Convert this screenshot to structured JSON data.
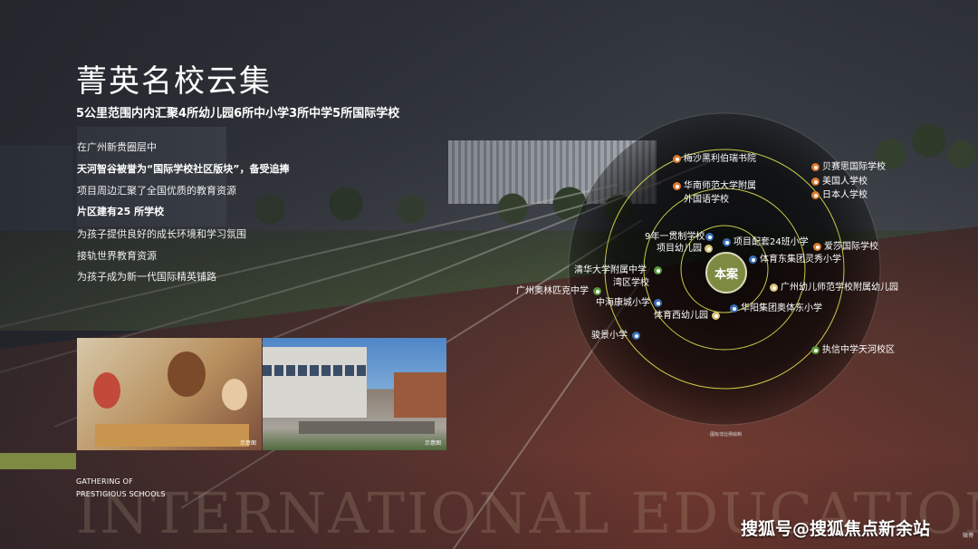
{
  "title": "菁英名校云集",
  "subtitle": "5公里范围内内汇聚4所幼儿园6所中小学3所中学5所国际学校",
  "desc": [
    "在广州新贵圈层中",
    "天河智谷被誉为“国际学校社区版块”，备受追捧",
    "项目周边汇聚了全国优质的教育资源",
    "片区建有25 所学校",
    "为孩子提供良好的成长环境和学习氛围",
    "接轨世界教育资源",
    "为孩子成为新一代国际精英铺路"
  ],
  "photos": {
    "caption1": "示意图",
    "caption2": "示意图"
  },
  "gathering": [
    "GATHERING OF",
    "PRESTIGIOUS SCHOOLS"
  ],
  "watermark": "INTERNATIONAL EDUCATION",
  "center_label": "本案",
  "map_note": "· 图标非比例绘制",
  "schools": [
    {
      "name": "梅沙黑利伯瑞书院",
      "color": "orange"
    },
    {
      "name": "华南师范大学附属",
      "color": "orange"
    },
    {
      "name": "外国语学校",
      "color": "orange"
    },
    {
      "name": "贝赛思国际学校",
      "color": "orange"
    },
    {
      "name": "美国人学校",
      "color": "orange"
    },
    {
      "name": "日本人学校",
      "color": "orange"
    },
    {
      "name": "爱莎国际学校",
      "color": "orange"
    },
    {
      "name": "9年一贯制学校",
      "color": "blue"
    },
    {
      "name": "项目幼儿园",
      "color": "yellow"
    },
    {
      "name": "项目配套24班小学",
      "color": "blue"
    },
    {
      "name": "体育东集团灵秀小学",
      "color": "blue"
    },
    {
      "name": "清华大学附属中学",
      "color": "green"
    },
    {
      "name": "湾区学校",
      "color": "green"
    },
    {
      "name": "广州奥林匹克中学",
      "color": "green"
    },
    {
      "name": "广州幼儿师范学校附属幼儿园",
      "color": "yellow"
    },
    {
      "name": "中海康城小学",
      "color": "blue"
    },
    {
      "name": "华阳集团奥体东小学",
      "color": "blue"
    },
    {
      "name": "体育西幼儿园",
      "color": "yellow"
    },
    {
      "name": "骏景小学",
      "color": "blue"
    },
    {
      "name": "执信中学天河校区",
      "color": "green"
    }
  ],
  "footer": {
    "sohu": "搜狐号@搜狐焦点新余站",
    "small": "微博"
  }
}
